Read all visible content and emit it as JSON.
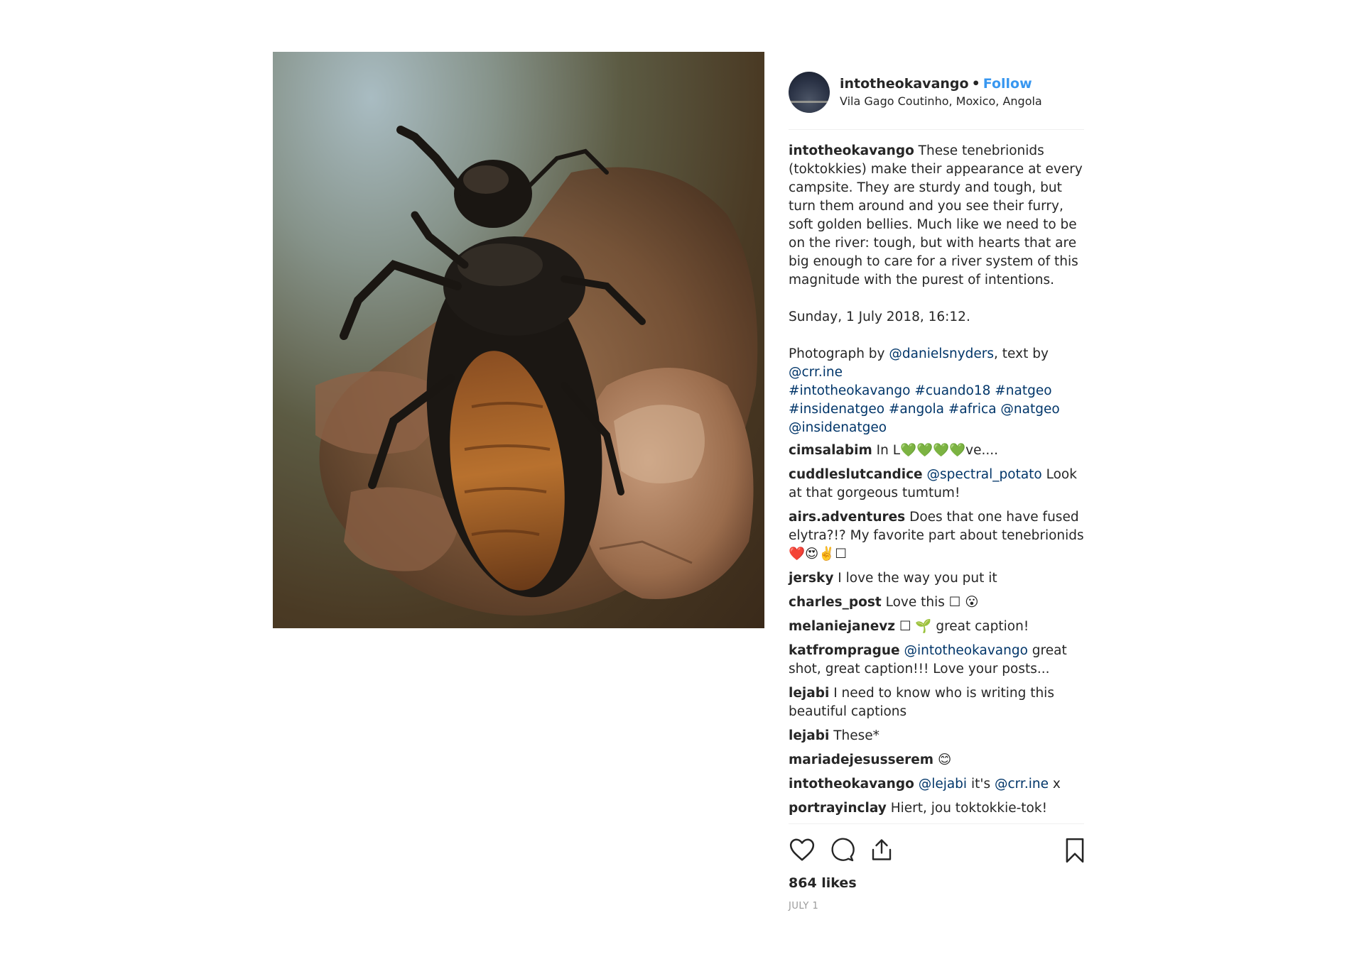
{
  "post": {
    "image_alt": "Beetle held upside down between fingers",
    "username": "intotheokavango",
    "separator": "•",
    "follow_label": "Follow",
    "location": "Vila Gago Coutinho, Moxico, Angola"
  },
  "caption": {
    "username": "intotheokavango",
    "text": " These tenebrionids (toktokkies) make their appearance at every campsite. They are sturdy and tough, but turn them around and you see their furry, soft golden bellies. Much like we need to be on the river: tough, but with hearts that are big enough to care for a river system of this magnitude with the purest of intentions.",
    "date_line": "Sunday, 1 July 2018, 16:12.",
    "credit_prefix": "Photograph by ",
    "credit_photographer": "@danielsnyders",
    "credit_mid": ", text by ",
    "credit_writer": "@crr.ine",
    "tags": [
      "#intotheokavango",
      "#cuando18",
      "#natgeo",
      "#insidenatgeo",
      "#angola",
      "#africa",
      "@natgeo",
      "@insidenatgeo"
    ]
  },
  "comments": [
    {
      "user": "cimsalabim",
      "parts": [
        {
          "t": " In L💚💚💚💚ve...."
        }
      ]
    },
    {
      "user": "cuddleslutcandice",
      "parts": [
        {
          "t": " "
        },
        {
          "t": "@spectral_potato",
          "link": true
        },
        {
          "t": " Look at that gorgeous tumtum!"
        }
      ]
    },
    {
      "user": "airs.adventures",
      "parts": [
        {
          "t": " Does that one have fused elytra?!? My favorite part about tenebrionids ❤️😍✌️☐"
        }
      ]
    },
    {
      "user": "jersky",
      "parts": [
        {
          "t": " I love the way you put it"
        }
      ]
    },
    {
      "user": "charles_post",
      "parts": [
        {
          "t": " Love this ☐ 😮"
        }
      ]
    },
    {
      "user": "melaniejanevz",
      "parts": [
        {
          "t": " ☐ 🌱 great caption!"
        }
      ]
    },
    {
      "user": "katfromprague",
      "parts": [
        {
          "t": " "
        },
        {
          "t": "@intotheokavango",
          "link": true
        },
        {
          "t": " great shot, great caption!!! Love your posts..."
        }
      ]
    },
    {
      "user": "lejabi",
      "parts": [
        {
          "t": " I need to know who is writing this beautiful captions"
        }
      ]
    },
    {
      "user": "lejabi",
      "parts": [
        {
          "t": " These*"
        }
      ]
    },
    {
      "user": "mariadejesusserem",
      "parts": [
        {
          "t": " 😊"
        }
      ]
    },
    {
      "user": "intotheokavango",
      "parts": [
        {
          "t": " "
        },
        {
          "t": "@lejabi",
          "link": true
        },
        {
          "t": " it's "
        },
        {
          "t": "@crr.ine",
          "link": true
        },
        {
          "t": " x"
        }
      ]
    },
    {
      "user": "portrayinclay",
      "parts": [
        {
          "t": " Hiert, jou toktokkie-tok!"
        }
      ]
    }
  ],
  "actions": {
    "like_icon": "heart-icon",
    "comment_icon": "comment-icon",
    "share_icon": "share-icon",
    "save_icon": "bookmark-icon"
  },
  "likes": "864 likes",
  "date": "JULY 1",
  "colors": {
    "link": "#003569",
    "follow": "#3897f0",
    "muted": "#999999",
    "text": "#262626"
  }
}
